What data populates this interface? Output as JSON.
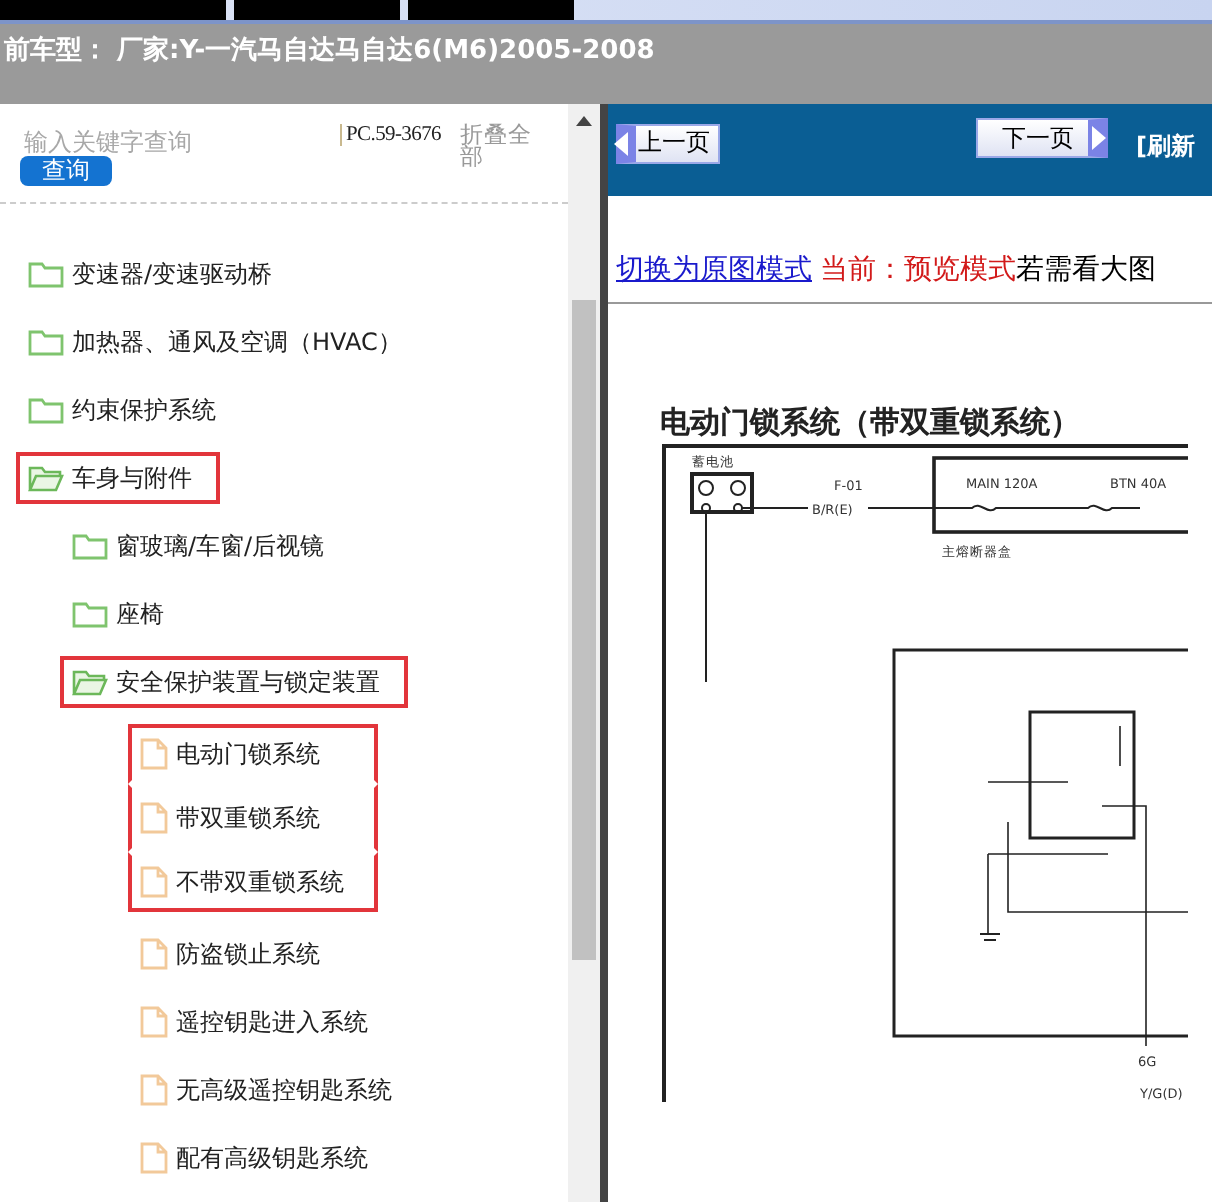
{
  "header": {
    "title": "前车型：  厂家:Y-一汽马自达马自达6(M6)2005-2008"
  },
  "search": {
    "placeholder": "输入关键字查询",
    "button": "查询",
    "code": "PC.59-3676",
    "collapse": "折叠全部"
  },
  "tree": [
    {
      "label": "变速器/变速驱动桥",
      "kind": "folder",
      "highlighted": false
    },
    {
      "label": "加热器、通风及空调（HVAC）",
      "kind": "folder",
      "highlighted": false
    },
    {
      "label": "约束保护系统",
      "kind": "folder",
      "highlighted": false
    },
    {
      "label": "车身与附件",
      "kind": "folder",
      "highlighted": true,
      "children": [
        {
          "label": "窗玻璃/车窗/后视镜",
          "kind": "folder",
          "highlighted": false
        },
        {
          "label": "座椅",
          "kind": "folder",
          "highlighted": false
        },
        {
          "label": "安全保护装置与锁定装置",
          "kind": "folder",
          "highlighted": true,
          "children": [
            {
              "label": "电动门锁系统",
              "kind": "file",
              "highlighted": true
            },
            {
              "label": "带双重锁系统",
              "kind": "file",
              "highlighted": true
            },
            {
              "label": "不带双重锁系统",
              "kind": "file",
              "highlighted": true
            },
            {
              "label": "防盗锁止系统",
              "kind": "file",
              "highlighted": false
            },
            {
              "label": "遥控钥匙进入系统",
              "kind": "file",
              "highlighted": false
            },
            {
              "label": "无高级遥控钥匙系统",
              "kind": "file",
              "highlighted": false
            },
            {
              "label": "配有高级钥匙系统",
              "kind": "file",
              "highlighted": false
            }
          ]
        }
      ]
    }
  ],
  "toolbar": {
    "prev": "上一页",
    "next": "下一页",
    "refresh": "[刷新"
  },
  "mode": {
    "link": "切换为原图模式",
    "current": "当前：预览模式",
    "hint": "若需看大图"
  },
  "diagram": {
    "title": "电动门锁系统（带双重锁系统）",
    "battery": "蓄电池",
    "connector": "F-01",
    "wire": "B/R(E)",
    "fuse_main": "MAIN 120A",
    "fuse_btn": "BTN 40A",
    "fuse_box": "主熔断器盒",
    "terminal": "6G",
    "wire_2": "Y/G(D)"
  }
}
